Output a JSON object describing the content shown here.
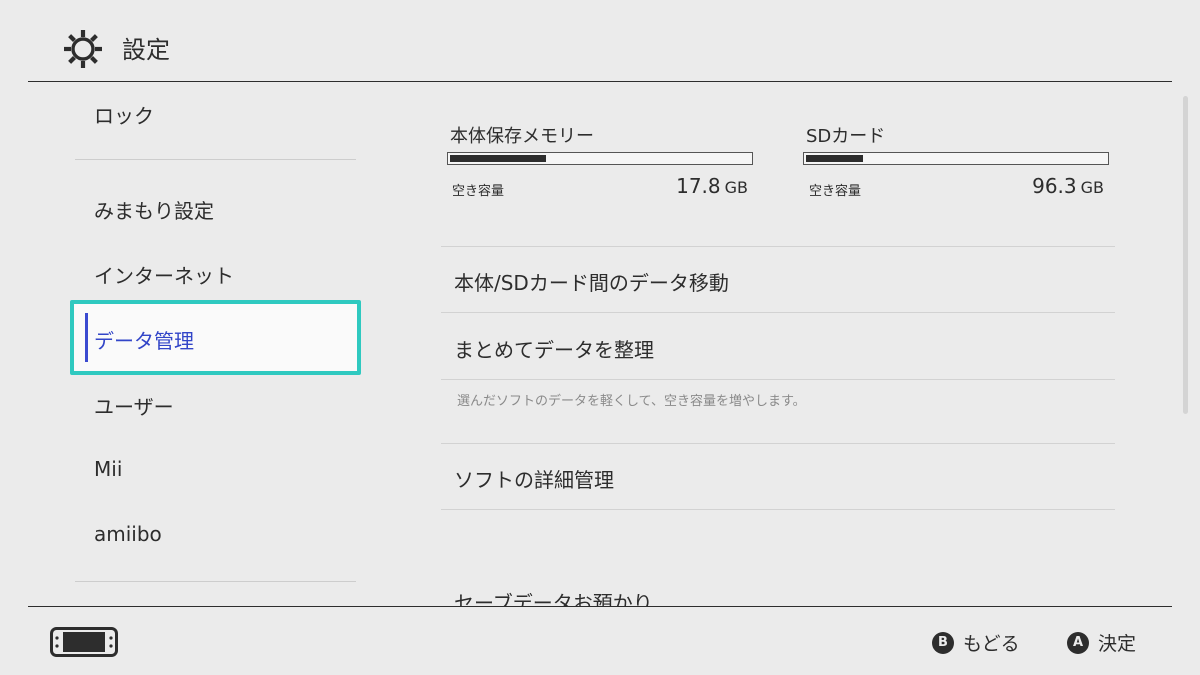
{
  "header": {
    "title": "設定",
    "icon": "gear-icon"
  },
  "sidebar": {
    "items": [
      {
        "label": "ロック"
      },
      {
        "label": "みまもり設定"
      },
      {
        "label": "インターネット"
      },
      {
        "label": "データ管理",
        "selected": true
      },
      {
        "label": "ユーザー"
      },
      {
        "label": "Mii"
      },
      {
        "label": "amiibo"
      }
    ],
    "selection_color": "#2fc9c0",
    "selected_text_color": "#3245c8"
  },
  "storage": {
    "system": {
      "label": "本体保存メモリー",
      "free_label": "空き容量",
      "free_value": "17.8",
      "unit": "GB",
      "used_fraction": 0.32
    },
    "sd": {
      "label": "SDカード",
      "free_label": "空き容量",
      "free_value": "96.3",
      "unit": "GB",
      "used_fraction": 0.19
    }
  },
  "main": {
    "items": [
      {
        "label": "本体/SDカード間のデータ移動"
      },
      {
        "label": "まとめてデータを整理",
        "description": "選んだソフトのデータを軽くして、空き容量を増やします。"
      },
      {
        "label": "ソフトの詳細管理"
      },
      {
        "label": "セーブデータお預かり"
      }
    ]
  },
  "footer": {
    "console_icon": "handheld-console-icon",
    "back": {
      "button": "B",
      "label": "もどる"
    },
    "ok": {
      "button": "A",
      "label": "決定"
    }
  }
}
